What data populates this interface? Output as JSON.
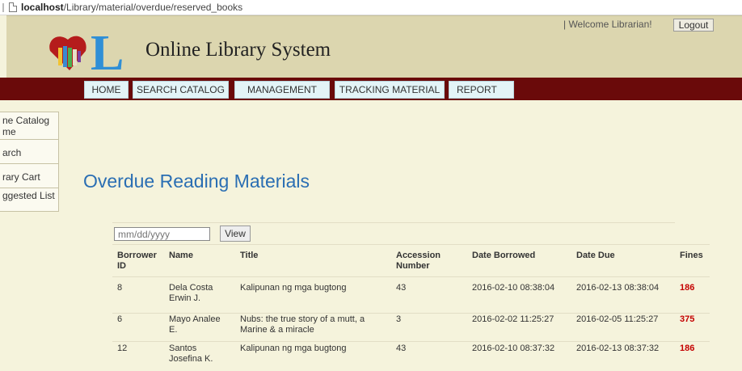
{
  "browser": {
    "url_host": "localhost",
    "url_path": "/Library/material/overdue/reserved_books"
  },
  "header": {
    "welcome_text": "| Welcome Librarian!",
    "logout_label": "Logout",
    "site_title": "Online Library System",
    "logo_letter": "L"
  },
  "nav": {
    "items": [
      {
        "label": "HOME"
      },
      {
        "label": "SEARCH CATALOG"
      },
      {
        "label": "MANAGEMENT"
      },
      {
        "label": "TRACKING MATERIAL"
      },
      {
        "label": "REPORT"
      }
    ]
  },
  "sidebar": {
    "items": [
      {
        "label": "ne Catalog"
      },
      {
        "label": "me"
      },
      {
        "label": "arch"
      },
      {
        "label": "rary Cart"
      },
      {
        "label": "ggested List"
      }
    ]
  },
  "main": {
    "title": "Overdue Reading Materials",
    "date_placeholder": "mm/dd/yyyy",
    "view_label": "View"
  },
  "table": {
    "headers": {
      "borrower_id_1": "Borrower",
      "borrower_id_2": "ID",
      "name": "Name",
      "title": "Title",
      "accession_1": "Accession",
      "accession_2": "Number",
      "date_borrowed": "Date Borrowed",
      "date_due": "Date Due",
      "fines": "Fines"
    },
    "rows": [
      {
        "id": "8",
        "name_1": "Dela Costa",
        "name_2": "Erwin J.",
        "title_1": "Kalipunan ng mga bugtong",
        "title_2": "",
        "accession": "43",
        "borrowed": "2016-02-10 08:38:04",
        "due": "2016-02-13 08:38:04",
        "fines": "186"
      },
      {
        "id": "6",
        "name_1": "Mayo Analee",
        "name_2": "E.",
        "title_1": "Nubs: the true story of a mutt, a",
        "title_2": "Marine & a miracle",
        "accession": "3",
        "borrowed": "2016-02-02 11:25:27",
        "due": "2016-02-05 11:25:27",
        "fines": "375"
      },
      {
        "id": "12",
        "name_1": "Santos",
        "name_2": "Josefina K.",
        "title_1": "Kalipunan ng mga bugtong",
        "title_2": "",
        "accession": "43",
        "borrowed": "2016-02-10 08:37:32",
        "due": "2016-02-13 08:37:32",
        "fines": "186"
      }
    ]
  },
  "colors": {
    "nav_background": "#6a0a0a",
    "header_background": "#dcd6af",
    "page_background": "#f5f3dc",
    "title_blue": "#2a6eb3",
    "fine_red": "#c40000"
  }
}
